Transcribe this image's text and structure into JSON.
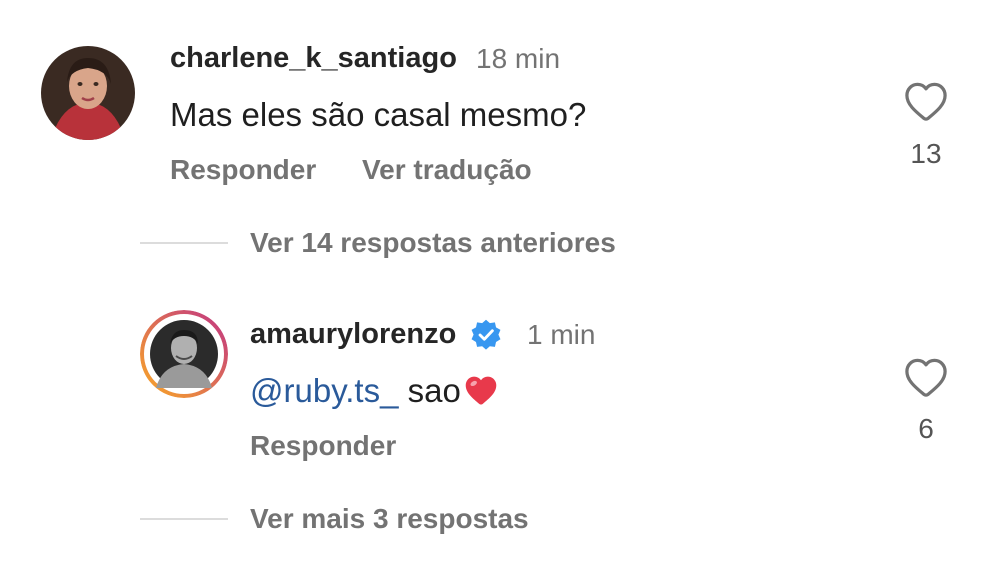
{
  "comment1": {
    "username": "charlene_k_santiago",
    "time": "18 min",
    "text": "Mas eles são casal mesmo?",
    "reply_label": "Responder",
    "translate_label": "Ver tradução",
    "like_count": "13"
  },
  "view_previous_replies": "Ver 14 respostas anteriores",
  "comment2": {
    "username": "amaurylorenzo",
    "verified": true,
    "time": "1 min",
    "mention": "@ruby.ts_",
    "text": "sao",
    "emoji": "heart-emoji",
    "reply_label": "Responder",
    "like_count": "6"
  },
  "view_more_replies": "Ver mais 3 respostas",
  "colors": {
    "mention": "#2a5a9a",
    "verified_badge": "#3897f0",
    "heart_emoji": "#e8394b",
    "story_ring_start": "#f9a826",
    "story_ring_end": "#c13584"
  }
}
